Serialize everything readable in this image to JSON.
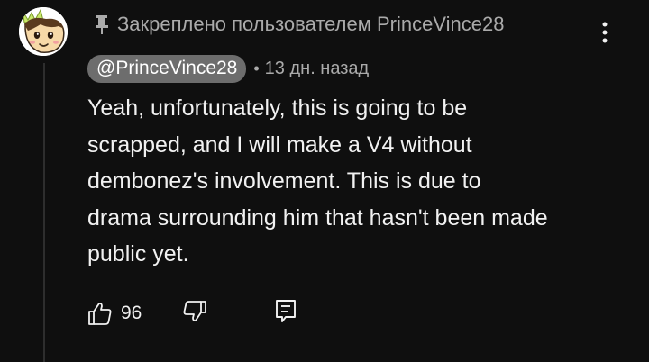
{
  "comment": {
    "pinned_text": "Закреплено пользователем PrinceVince28",
    "author": "@PrinceVince28",
    "separator": "•",
    "timestamp": "13 дн. назад",
    "text": "Yeah, unfortunately, this is going to be\nscrapped, and I will make a V4 without\ndembonez's involvement. This is due to\ndrama surrounding him that hasn't been made\npublic yet.",
    "like_count": "96"
  },
  "icons": {
    "pin": "pin-icon",
    "menu": "vertical-ellipsis-icon",
    "like": "thumbs-up-icon",
    "dislike": "thumbs-down-icon",
    "reply": "reply-comment-icon",
    "avatar": "cartoon-face-avatar"
  },
  "colors": {
    "background": "#0f0f0f",
    "text_primary": "#f1f1f1",
    "text_secondary": "#aaaaaa",
    "author_chip": "#6d6d6d"
  }
}
